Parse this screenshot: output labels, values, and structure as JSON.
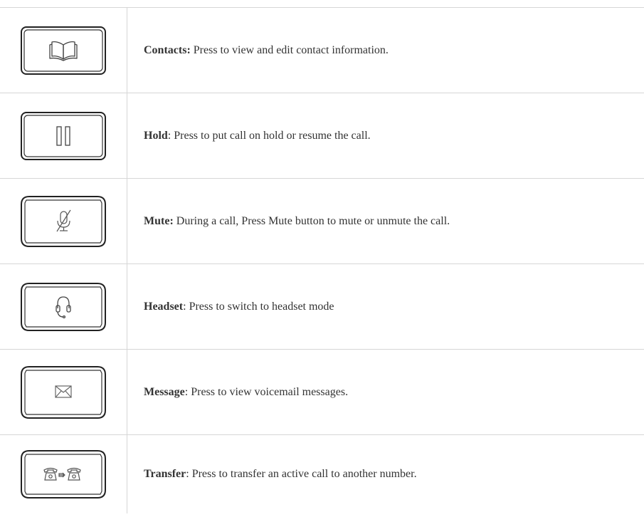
{
  "rows": [
    {
      "name": "Contacts",
      "sep": ":",
      "text": " Press to view and edit contact information.",
      "icon": "contacts-book-icon"
    },
    {
      "name": "Hold",
      "sep": ":",
      "text": " Press to put call on hold or resume the call.",
      "icon": "hold-pause-icon"
    },
    {
      "name": "Mute",
      "sep": ":",
      "text": " During a call, Press Mute button to mute or unmute the call.",
      "icon": "mute-microphone-icon"
    },
    {
      "name": "Headset",
      "sep": ":",
      "text": " Press to switch to headset mode",
      "icon": "headset-icon"
    },
    {
      "name": "Message",
      "sep": ":",
      "text": " Press to view voicemail messages.",
      "icon": "envelope-message-icon"
    },
    {
      "name": "Transfer",
      "sep": ":",
      "text": " Press to transfer an active call to another number.",
      "icon": "transfer-phone-icon"
    }
  ]
}
